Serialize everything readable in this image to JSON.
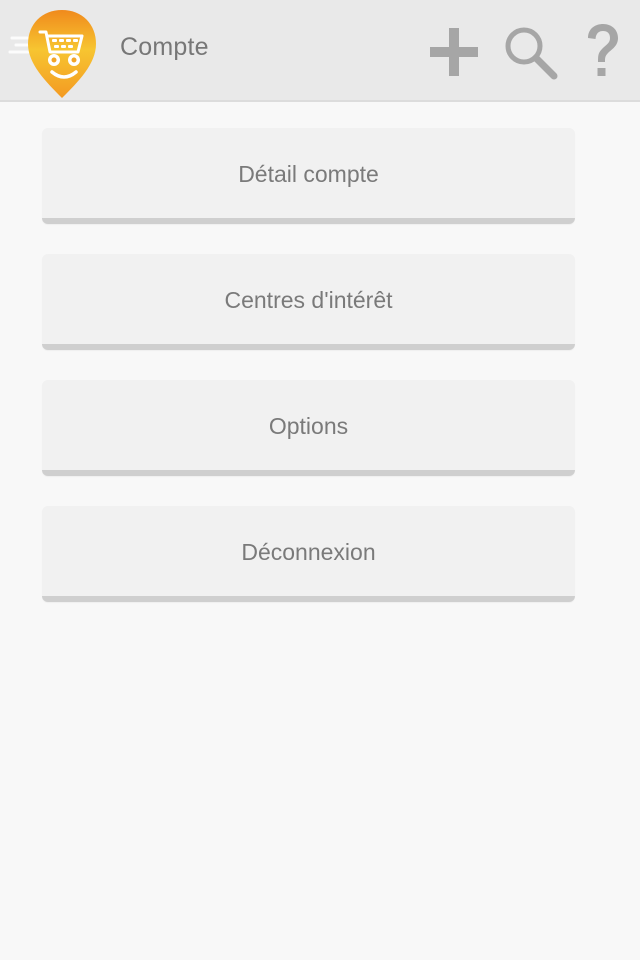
{
  "header": {
    "title": "Compte",
    "logo_icon": "shopping-cart-mascot-icon",
    "actions": [
      {
        "name": "add",
        "icon": "plus-icon"
      },
      {
        "name": "search",
        "icon": "magnifier-icon"
      },
      {
        "name": "help",
        "icon": "question-mark-icon"
      }
    ],
    "help_glyph": "?"
  },
  "menu": {
    "items": [
      {
        "label": "Détail compte"
      },
      {
        "label": "Centres d'intérêt"
      },
      {
        "label": "Options"
      },
      {
        "label": "Déconnexion"
      }
    ]
  },
  "colors": {
    "header_bg": "#e9e9e9",
    "page_bg": "#f8f8f8",
    "button_bg": "#f1f1f1",
    "button_edge": "#cfcfcf",
    "text": "#7a7a7a",
    "icon": "#a6a6a6",
    "logo_orange": "#f29a1f",
    "logo_yellow": "#f7d43a"
  }
}
